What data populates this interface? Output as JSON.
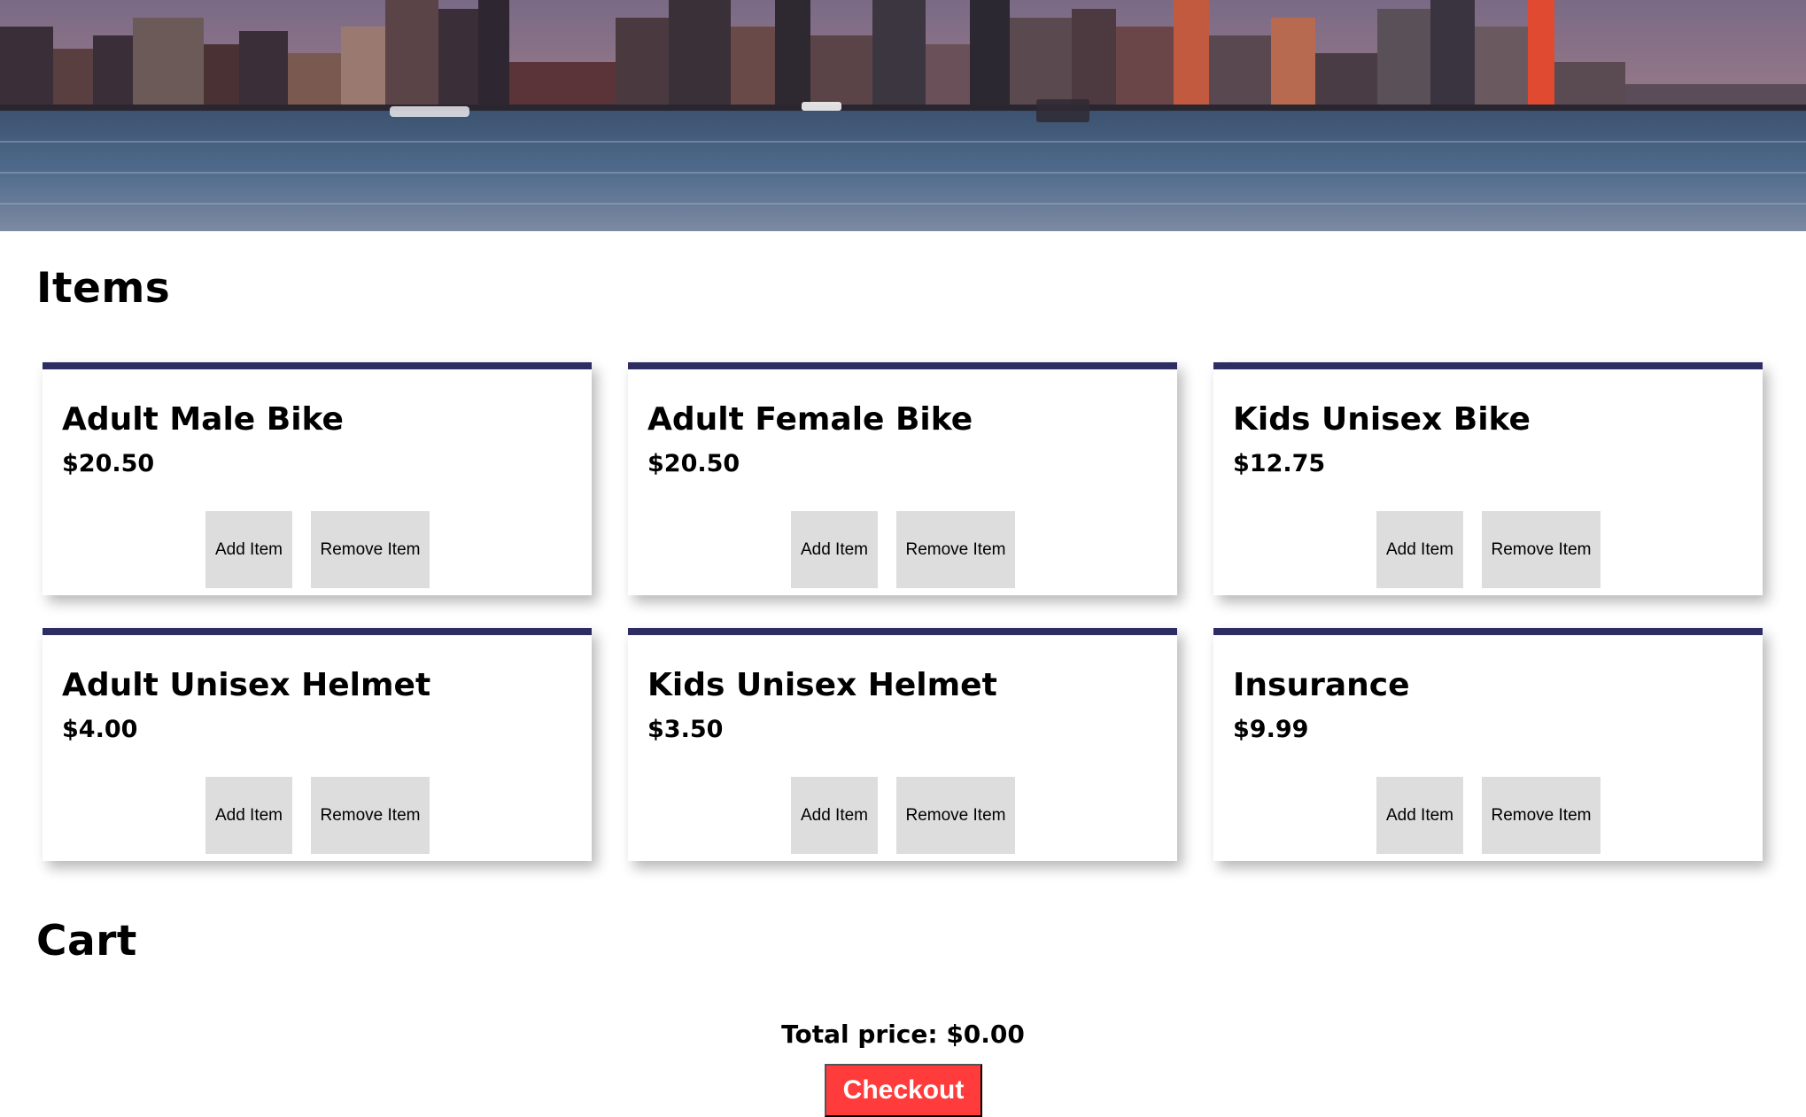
{
  "hero": {
    "image_name": "city-skyline-waterfront-banner"
  },
  "items_section": {
    "title": "Items",
    "cards": [
      {
        "name": "Adult Male Bike",
        "price": "$20.50",
        "add_label": "Add Item",
        "remove_label": "Remove Item"
      },
      {
        "name": "Adult Female Bike",
        "price": "$20.50",
        "add_label": "Add Item",
        "remove_label": "Remove Item"
      },
      {
        "name": "Kids Unisex Bike",
        "price": "$12.75",
        "add_label": "Add Item",
        "remove_label": "Remove Item"
      },
      {
        "name": "Adult Unisex Helmet",
        "price": "$4.00",
        "add_label": "Add Item",
        "remove_label": "Remove Item"
      },
      {
        "name": "Kids Unisex Helmet",
        "price": "$3.50",
        "add_label": "Add Item",
        "remove_label": "Remove Item"
      },
      {
        "name": "Insurance",
        "price": "$9.99",
        "add_label": "Add Item",
        "remove_label": "Remove Item"
      }
    ]
  },
  "cart_section": {
    "title": "Cart",
    "total_text": "Total price: $0.00",
    "checkout_label": "Checkout"
  },
  "colors": {
    "card_top_border": "#2d2d63",
    "button_bg": "#dddddd",
    "checkout_bg": "#ff3b3b"
  }
}
